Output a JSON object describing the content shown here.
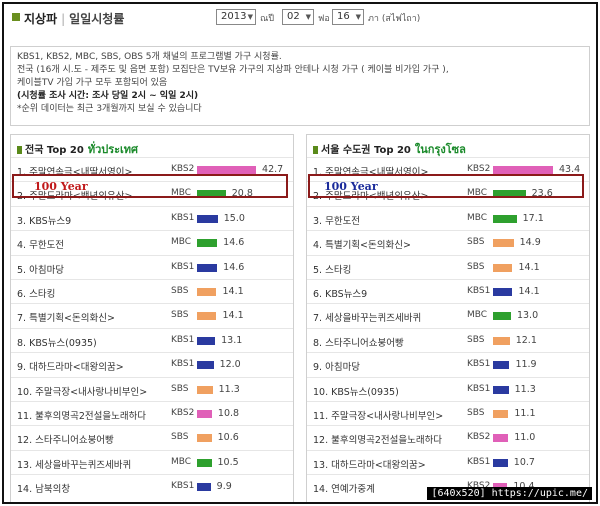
{
  "header": {
    "title": "지상파",
    "separator": "|",
    "subtitle": "일일시청률",
    "year": "2013",
    "year_label": "ณปี",
    "month": "02",
    "month_label": "ฟอ",
    "day": "16",
    "day_label": "ภา (สไฟไถา)"
  },
  "description": {
    "line1": "KBS1, KBS2, MBC, SBS, OBS 5개 채널의 프로그램별 가구 시청률.",
    "line2": "전국 (16개 시.도 - 제주도 및 읍면 포함) 모집단은 TV보유 가구의 지상파 안테나 시청 가구 ( 케이블 비가입 가구 ),",
    "line3": "케이블TV 가입 가구 모두 포함되어 있음",
    "line4": "(시청률 조사 시간: 조사 당일 2시 ~ 익일 2시)",
    "line5": "*순위 데이터는 최근 3개월까지 보실 수 있습니다"
  },
  "annotation": {
    "label": "100 Year",
    "color_left": "#c0181a",
    "color_right": "#1a2a9a",
    "box_color": "#8b1a1a"
  },
  "channel_colors": {
    "KBS2": "#e060b8",
    "MBC": "#2ea02e",
    "KBS1": "#2a3aa0",
    "SBS": "#f0a060"
  },
  "left": {
    "title": "전국 Top 20",
    "title_thai": "ทั่วประเทศ",
    "rows": [
      {
        "name": "1. 주말연속극<내딸서영이>",
        "channel": "KBS2",
        "value": 42.7
      },
      {
        "name": "2. 주말드라마<백년의유산>",
        "channel": "MBC",
        "value": 20.8
      },
      {
        "name": "3. KBS뉴스9",
        "channel": "KBS1",
        "value": 15.0
      },
      {
        "name": "4. 무한도전",
        "channel": "MBC",
        "value": 14.6
      },
      {
        "name": "5. 아침마당",
        "channel": "KBS1",
        "value": 14.6
      },
      {
        "name": "6. 스타킹",
        "channel": "SBS",
        "value": 14.1
      },
      {
        "name": "7. 특별기획<돈의화신>",
        "channel": "SBS",
        "value": 14.1
      },
      {
        "name": "8. KBS뉴스(0935)",
        "channel": "KBS1",
        "value": 13.1
      },
      {
        "name": "9. 대하드라마<대왕의꿈>",
        "channel": "KBS1",
        "value": 12.0
      },
      {
        "name": "10. 주말극장<내사랑나비부인>",
        "channel": "SBS",
        "value": 11.3
      },
      {
        "name": "11. 불후의명곡2전설을노래하다",
        "channel": "KBS2",
        "value": 10.8
      },
      {
        "name": "12. 스타주니어쇼붕어빵",
        "channel": "SBS",
        "value": 10.6
      },
      {
        "name": "13. 세상을바꾸는퀴즈세바퀴",
        "channel": "MBC",
        "value": 10.5
      },
      {
        "name": "14. 남북의창",
        "channel": "KBS1",
        "value": 9.9
      }
    ]
  },
  "right": {
    "title": "서울 수도권 Top 20",
    "title_thai": "ในกรุงโซล",
    "rows": [
      {
        "name": "1. 주말연속극<내딸서영이>",
        "channel": "KBS2",
        "value": 43.4
      },
      {
        "name": "2. 주말드라마<백년의유산>",
        "channel": "MBC",
        "value": 23.6
      },
      {
        "name": "3. 무한도전",
        "channel": "MBC",
        "value": 17.1
      },
      {
        "name": "4. 특별기획<돈의화신>",
        "channel": "SBS",
        "value": 14.9
      },
      {
        "name": "5. 스타킹",
        "channel": "SBS",
        "value": 14.1
      },
      {
        "name": "6. KBS뉴스9",
        "channel": "KBS1",
        "value": 14.1
      },
      {
        "name": "7. 세상을바꾸는퀴즈세바퀴",
        "channel": "MBC",
        "value": 13.0
      },
      {
        "name": "8. 스타주니어쇼붕어빵",
        "channel": "SBS",
        "value": 12.1
      },
      {
        "name": "9. 아침마당",
        "channel": "KBS1",
        "value": 11.9
      },
      {
        "name": "10. KBS뉴스(0935)",
        "channel": "KBS1",
        "value": 11.3
      },
      {
        "name": "11. 주말극장<내사랑나비부인>",
        "channel": "SBS",
        "value": 11.1
      },
      {
        "name": "12. 불후의명곡2전설을노래하다",
        "channel": "KBS2",
        "value": 11.0
      },
      {
        "name": "13. 대하드라마<대왕의꿈>",
        "channel": "KBS1",
        "value": 10.7
      },
      {
        "name": "14. 연예가중계",
        "channel": "KBS2",
        "value": 10.4
      }
    ]
  },
  "footer": {
    "watermark": "[640x520] https://upic.me/"
  }
}
